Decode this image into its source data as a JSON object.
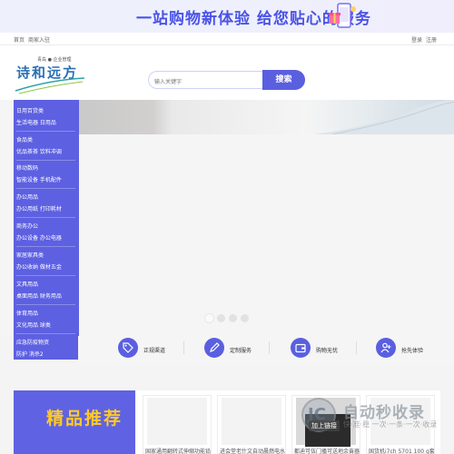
{
  "banner": {
    "text": "一站购物新体验 给您贴心的服务"
  },
  "topbar": {
    "home": "首页",
    "merchant": "商家入驻",
    "login": "登录",
    "register": "注册"
  },
  "logo": {
    "subtitle": "青岛 ● 企业管理",
    "name": "诗和远方"
  },
  "search": {
    "placeholder": "输入关键字",
    "button": "搜索"
  },
  "categories": [
    {
      "title": "日用百货类",
      "sub": "生活电器 日用品"
    },
    {
      "title": "食品类",
      "sub": "优品茶茶 饮料冲调"
    },
    {
      "title": "移动数码",
      "sub": "智能设备 手机配件"
    },
    {
      "title": "办公用品",
      "sub": "办公用纸 打印耗材"
    },
    {
      "title": "商务办公",
      "sub": "办公设备 办公电器"
    },
    {
      "title": "家居家具类",
      "sub": "办公收纳 做材五金"
    },
    {
      "title": "文具用品",
      "sub": "桌面用品 财务用品"
    },
    {
      "title": "体育用品",
      "sub": "文化用品 球类"
    },
    {
      "title": "应急防疫物资",
      "sub": "防护 消杀2"
    }
  ],
  "features": [
    {
      "label": "正规渠道",
      "icon": "tag-icon"
    },
    {
      "label": "定制服务",
      "icon": "pen-icon"
    },
    {
      "label": "购物无忧",
      "icon": "wallet-icon"
    },
    {
      "label": "抢先体验",
      "icon": "person-icon"
    }
  ],
  "selection": {
    "title": "精品推荐",
    "cards": [
      {
        "caption": "国家通用翻转式伸缩功能铅笔"
      },
      {
        "caption": "进会堂老什文自动晨燃电水"
      },
      {
        "caption": "都迪可伍门播可送地余奋器"
      },
      {
        "caption": "国货机i7ch 5701 100 g套"
      }
    ]
  },
  "watermark": {
    "title": "自动秒收录",
    "subtitle": "快·准·稳 一次·一条·一次·收录",
    "tag": "加上链接"
  },
  "colors": {
    "accent": "#5a5fe0",
    "highlight": "#ffc928",
    "banner_text": "#4a53e6"
  }
}
